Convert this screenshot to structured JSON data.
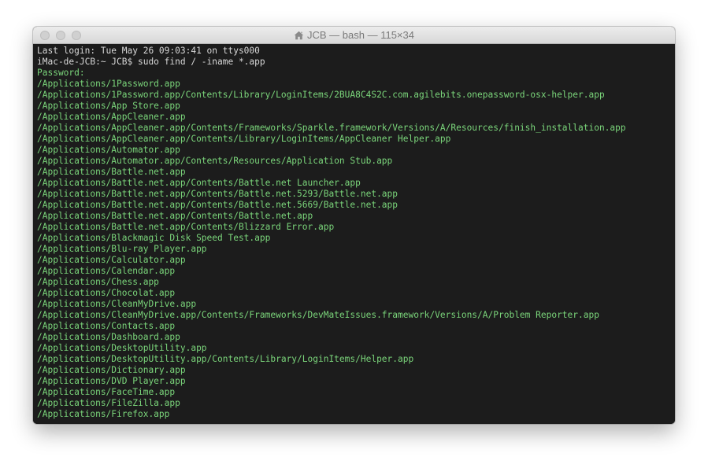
{
  "window": {
    "title": "JCB — bash — 115×34",
    "title_icon": "home-icon"
  },
  "colors": {
    "terminal_bg": "#1c1c1c",
    "terminal_fg": "#7bd67b",
    "header_fg": "#d8d8d8",
    "titlebar_bg": "#e2e2e2"
  },
  "terminal": {
    "header": {
      "last_login": "Last login: Tue May 26 09:03:41 on ttys000",
      "prompt": "iMac-de-JCB:~ JCB$ sudo find / -iname *.app",
      "password": "Password:"
    },
    "lines": [
      "/Applications/1Password.app",
      "/Applications/1Password.app/Contents/Library/LoginItems/2BUA8C4S2C.com.agilebits.onepassword-osx-helper.app",
      "/Applications/App Store.app",
      "/Applications/AppCleaner.app",
      "/Applications/AppCleaner.app/Contents/Frameworks/Sparkle.framework/Versions/A/Resources/finish_installation.app",
      "/Applications/AppCleaner.app/Contents/Library/LoginItems/AppCleaner Helper.app",
      "/Applications/Automator.app",
      "/Applications/Automator.app/Contents/Resources/Application Stub.app",
      "/Applications/Battle.net.app",
      "/Applications/Battle.net.app/Contents/Battle.net Launcher.app",
      "/Applications/Battle.net.app/Contents/Battle.net.5293/Battle.net.app",
      "/Applications/Battle.net.app/Contents/Battle.net.5669/Battle.net.app",
      "/Applications/Battle.net.app/Contents/Battle.net.app",
      "/Applications/Battle.net.app/Contents/Blizzard Error.app",
      "/Applications/Blackmagic Disk Speed Test.app",
      "/Applications/Blu-ray Player.app",
      "/Applications/Calculator.app",
      "/Applications/Calendar.app",
      "/Applications/Chess.app",
      "/Applications/Chocolat.app",
      "/Applications/CleanMyDrive.app",
      "/Applications/CleanMyDrive.app/Contents/Frameworks/DevMateIssues.framework/Versions/A/Problem Reporter.app",
      "/Applications/Contacts.app",
      "/Applications/Dashboard.app",
      "/Applications/DesktopUtility.app",
      "/Applications/DesktopUtility.app/Contents/Library/LoginItems/Helper.app",
      "/Applications/Dictionary.app",
      "/Applications/DVD Player.app",
      "/Applications/FaceTime.app",
      "/Applications/FileZilla.app",
      "/Applications/Firefox.app"
    ]
  }
}
